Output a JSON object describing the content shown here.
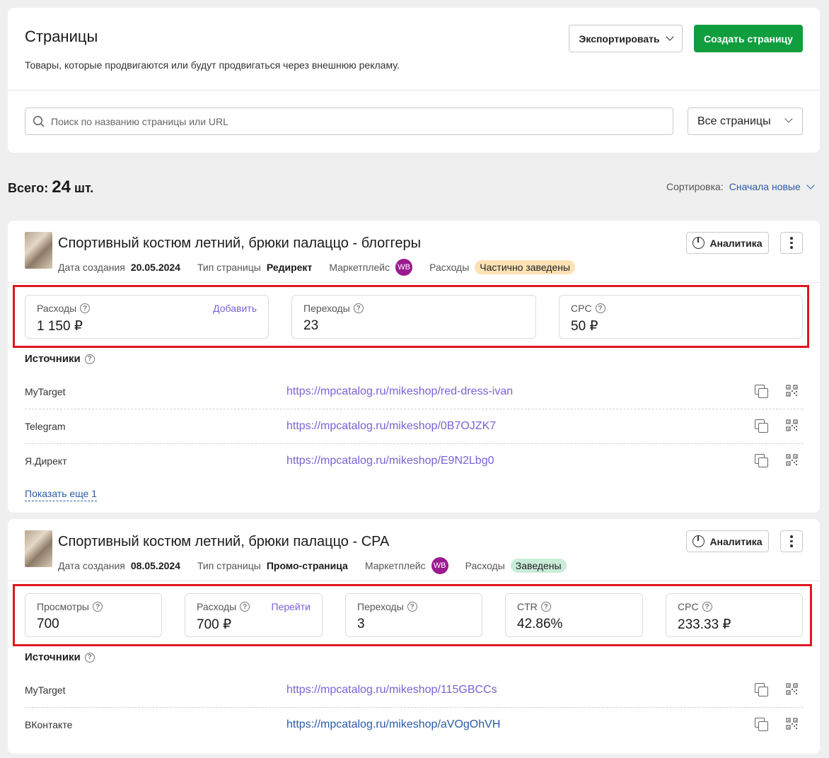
{
  "header": {
    "title": "Страницы",
    "subtitle": "Товары, которые продвигаются или будут продвигаться через внешнюю рекламу.",
    "export_label": "Экспортировать",
    "create_label": "Создать страницу"
  },
  "search": {
    "placeholder": "Поиск по названию страницы или URL",
    "filter_value": "Все страницы"
  },
  "summary": {
    "total_prefix": "Всего:",
    "total_count": "24",
    "total_suffix": "шт.",
    "sort_label": "Сортировка:",
    "sort_value": "Сначала новые"
  },
  "colors": {
    "accent_green": "#0f9d3e",
    "link_purple": "#7b61d6",
    "highlight_red": "#e0161e",
    "badge_partial": "#fbe1b4",
    "badge_done": "#c9ecd8"
  },
  "cards": [
    {
      "title": "Спортивный костюм летний, брюки палаццо - блоггеры",
      "created_label": "Дата создания",
      "created_value": "20.05.2024",
      "type_label": "Тип страницы",
      "type_value": "Редирект",
      "marketplace_label": "Маркетплейс",
      "marketplace_badge": "WB",
      "expenses_label": "Расходы",
      "expenses_status": "Частично заведены",
      "analytics_label": "Аналитика",
      "metrics": [
        {
          "label": "Расходы",
          "value": "1 150 ₽",
          "action": "Добавить"
        },
        {
          "label": "Переходы",
          "value": "23"
        },
        {
          "label": "CPC",
          "value": "50 ₽"
        }
      ],
      "sources_label": "Источники",
      "sources": [
        {
          "name": "MyTarget",
          "url": "https://mpcatalog.ru/mikeshop/red-dress-ivan"
        },
        {
          "name": "Telegram",
          "url": "https://mpcatalog.ru/mikeshop/0B7OJZK7"
        },
        {
          "name": "Я.Директ",
          "url": "https://mpcatalog.ru/mikeshop/E9N2Lbg0"
        }
      ],
      "show_more": "Показать еще 1"
    },
    {
      "title": "Спортивный костюм летний, брюки палаццо - CPA",
      "created_label": "Дата создания",
      "created_value": "08.05.2024",
      "type_label": "Тип страницы",
      "type_value": "Промо-страница",
      "marketplace_label": "Маркетплейс",
      "marketplace_badge": "WB",
      "expenses_label": "Расходы",
      "expenses_status": "Заведены",
      "analytics_label": "Аналитика",
      "metrics": [
        {
          "label": "Просмотры",
          "value": "700"
        },
        {
          "label": "Расходы",
          "value": "700 ₽",
          "action": "Перейти"
        },
        {
          "label": "Переходы",
          "value": "3"
        },
        {
          "label": "CTR",
          "value": "42.86%"
        },
        {
          "label": "CPC",
          "value": "233.33 ₽"
        }
      ],
      "sources_label": "Источники",
      "sources": [
        {
          "name": "MyTarget",
          "url": "https://mpcatalog.ru/mikeshop/115GBCCs"
        },
        {
          "name": "ВКонтакте",
          "url": "https://mpcatalog.ru/mikeshop/aVOgOhVH"
        }
      ]
    }
  ]
}
